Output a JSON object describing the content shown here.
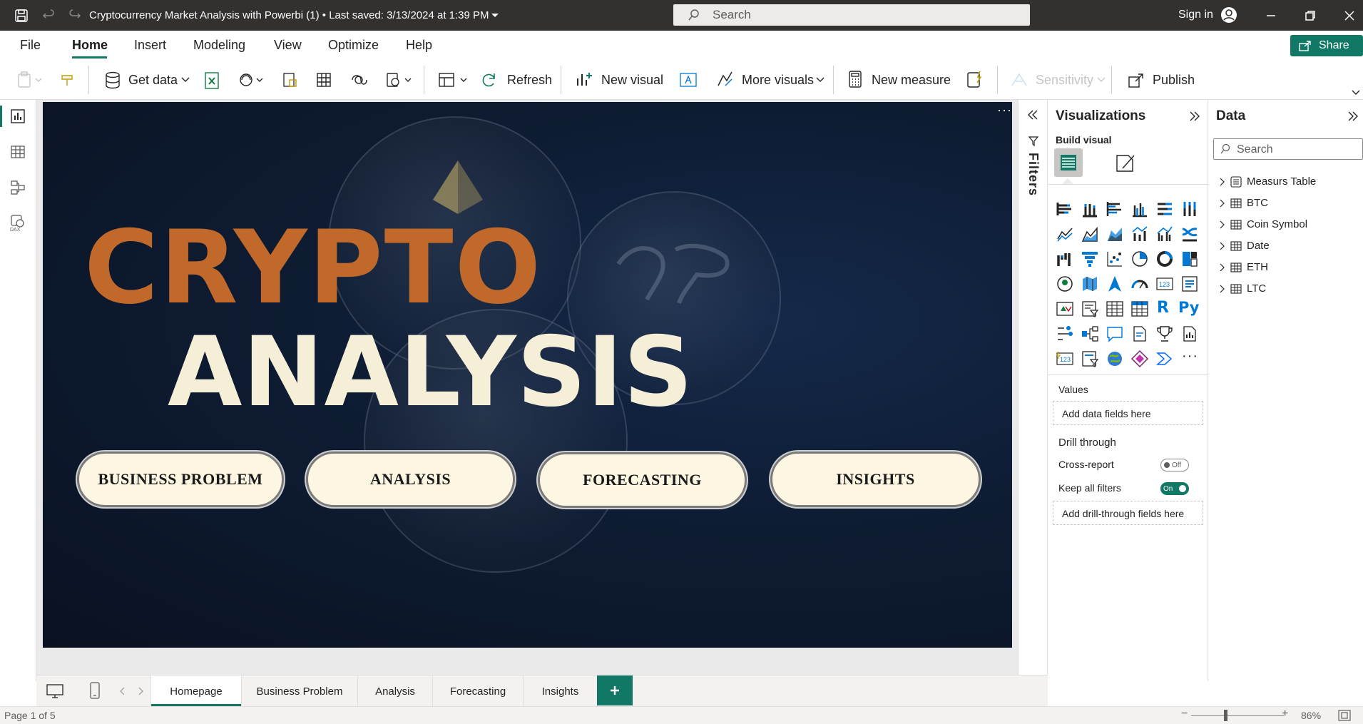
{
  "titlebar": {
    "doc_title": "Cryptocurrency Market Analysis with Powerbi (1)",
    "saved": "Last saved: 3/13/2024 at 1:39 PM",
    "search_placeholder": "Search",
    "signin": "Sign in"
  },
  "menu": {
    "items": [
      "File",
      "Home",
      "Insert",
      "Modeling",
      "View",
      "Optimize",
      "Help"
    ],
    "active": "Home",
    "share": "Share"
  },
  "ribbon": {
    "get_data": "Get data",
    "refresh": "Refresh",
    "new_visual": "New visual",
    "more_visuals": "More visuals",
    "new_measure": "New measure",
    "sensitivity": "Sensitivity",
    "publish": "Publish"
  },
  "canvas": {
    "headline1": "CRYPTO",
    "headline2": "ANALYSIS",
    "buttons": [
      "BUSINESS PROBLEM",
      "ANALYSIS",
      "FORECASTING",
      "INSIGHTS"
    ]
  },
  "filters": {
    "label": "Filters"
  },
  "visualizations": {
    "title": "Visualizations",
    "build_visual": "Build visual",
    "values_label": "Values",
    "values_placeholder": "Add data fields here",
    "drill_through": "Drill through",
    "cross_report": "Cross-report",
    "cross_report_state": "Off",
    "keep_filters": "Keep all filters",
    "keep_filters_state": "On",
    "drill_placeholder": "Add drill-through fields here"
  },
  "data_pane": {
    "title": "Data",
    "search_placeholder": "Search",
    "tables": [
      "Measurs Table",
      "BTC",
      "Coin Symbol",
      "Date",
      "ETH",
      "LTC"
    ]
  },
  "pages": {
    "tabs": [
      "Homepage",
      "Business Problem",
      "Analysis",
      "Forecasting",
      "Insights"
    ],
    "active": "Homepage"
  },
  "status": {
    "page_info": "Page 1 of 5",
    "zoom": "86%"
  },
  "colors": {
    "accent": "#117865",
    "crypto_orange": "#c0692a",
    "analysis_cream": "#f6efd8"
  }
}
